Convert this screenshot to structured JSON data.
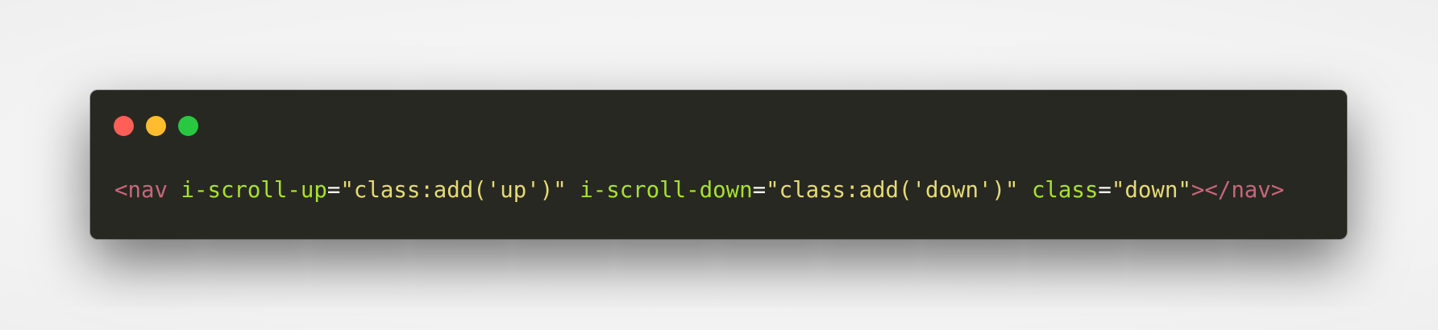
{
  "window": {
    "background": "#282822",
    "controls": [
      {
        "name": "close",
        "color": "#ff5f57"
      },
      {
        "name": "minimize",
        "color": "#febc2e"
      },
      {
        "name": "zoom",
        "color": "#28c840"
      }
    ]
  },
  "code": {
    "tag_open": "<nav",
    "attr1_name": "i-scroll-up",
    "attr1_eq": "=",
    "attr1_value": "\"class:add('up')\"",
    "attr2_name": "i-scroll-down",
    "attr2_eq": "=",
    "attr2_value": "\"class:add('down')\"",
    "attr3_name": "class",
    "attr3_eq": "=",
    "attr3_value": "\"down\"",
    "tag_close": "></nav>"
  },
  "colors": {
    "tag": "#c9667b",
    "attribute": "#a6e22e",
    "string": "#e6db74",
    "punctuation": "#f8f8f2"
  }
}
